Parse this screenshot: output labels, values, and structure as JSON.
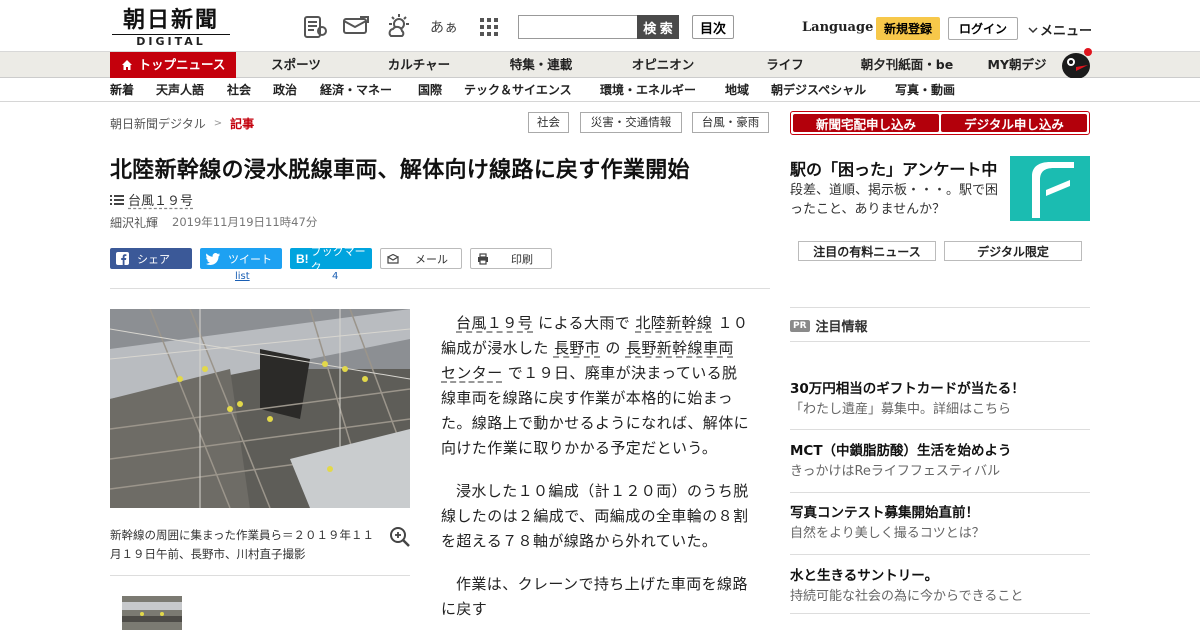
{
  "header": {
    "logo_main": "朝日新聞",
    "logo_sub": "DIGITAL",
    "icons": [
      "news-reader-icon",
      "chat-icon",
      "weather-icon",
      "font-size-icon",
      "apps-grid-icon"
    ],
    "font_icon_text": "あぁ",
    "search_placeholder": "",
    "search_button": "検 索",
    "toc_button": "目次",
    "language": "Language",
    "register": "新規登録",
    "login": "ログイン",
    "menu": "メニュー"
  },
  "nav_primary": [
    "トップニュース",
    "スポーツ",
    "カルチャー",
    "特集・連載",
    "オピニオン",
    "ライフ",
    "朝夕刊紙面・be",
    "MY朝デジ"
  ],
  "nav_secondary": [
    "新着",
    "天声人語",
    "社会",
    "政治",
    "経済・マネー",
    "国際",
    "テック＆サイエンス",
    "環境・エネルギー",
    "地域",
    "朝デジスペシャル",
    "写真・動画"
  ],
  "breadcrumb": {
    "root": "朝日新聞デジタル",
    "separator": ">",
    "current": "記事"
  },
  "tags": [
    "社会",
    "災害・交通情報",
    "台風・豪雨"
  ],
  "article": {
    "title": "北陸新幹線の浸水脱線車両、解体向け線路に戻す作業開始",
    "series": "台風１９号",
    "author": "細沢礼輝",
    "date": "2019年11月19日11時47分",
    "share": {
      "facebook": "シェア",
      "twitter": "ツイート",
      "twitter_count": "list",
      "hatena": "ブックマーク",
      "hatena_count": "4",
      "mail": "メール",
      "print": "印刷"
    },
    "photo_caption": "新幹線の周囲に集まった作業員ら＝２０１９年１１月１９日午前、長野市、川村直子撮影",
    "p1": [
      {
        "text": "台風１９号",
        "link": true
      },
      {
        "text": " による大雨で ",
        "link": false
      },
      {
        "text": "北陸新幹線",
        "link": true
      },
      {
        "text": " １０編成が浸水した ",
        "link": false
      },
      {
        "text": "長野市",
        "link": true
      },
      {
        "text": " の ",
        "link": false
      },
      {
        "text": "長野新幹線車両センター",
        "link": true
      },
      {
        "text": " で１９日、廃車が決まっている脱線車両を線路に戻す作業が本格的に始まった。線路上で動かせるようになれば、解体に向けた作業に取りかかる予定だという。",
        "link": false
      }
    ],
    "p2": "浸水した１０編成（計１２０両）のうち脱線したのは２編成で、両編成の全車輪の８割を超える７８軸が線路から外れていた。",
    "p3": "作業は、クレーンで持ち上げた車両を線路に戻す"
  },
  "sidebar": {
    "subscribe_paper": "新聞宅配申し込み",
    "subscribe_digital": "デジタル申し込み",
    "promo_title": "駅の「困った」アンケート中",
    "promo_text": "段差、道順、掲示板・・・。駅で困ったこと、ありませんか？",
    "btn_paid": "注目の有料ニュース",
    "btn_digital": "デジタル限定",
    "pr_badge": "PR",
    "pr_heading": "注目情報",
    "pr_items": [
      {
        "title": "30万円相当のギフトカードが当たる！",
        "sub": "「わたし遺産」募集中。詳細はこちら"
      },
      {
        "title": "MCT（中鎖脂肪酸）生活を始めよう",
        "sub": "きっかけはReライフフェスティバル"
      },
      {
        "title": "写真コンテスト募集開始直前！",
        "sub": "自然をより美しく撮るコツとは？"
      },
      {
        "title": "水と生きるサントリー。",
        "sub": "持続可能な社会の為に今からできること"
      }
    ]
  },
  "colors": {
    "accent_red": "#c4000c",
    "register_yellow": "#f7c84a",
    "promo_teal": "#1bbcb1"
  }
}
